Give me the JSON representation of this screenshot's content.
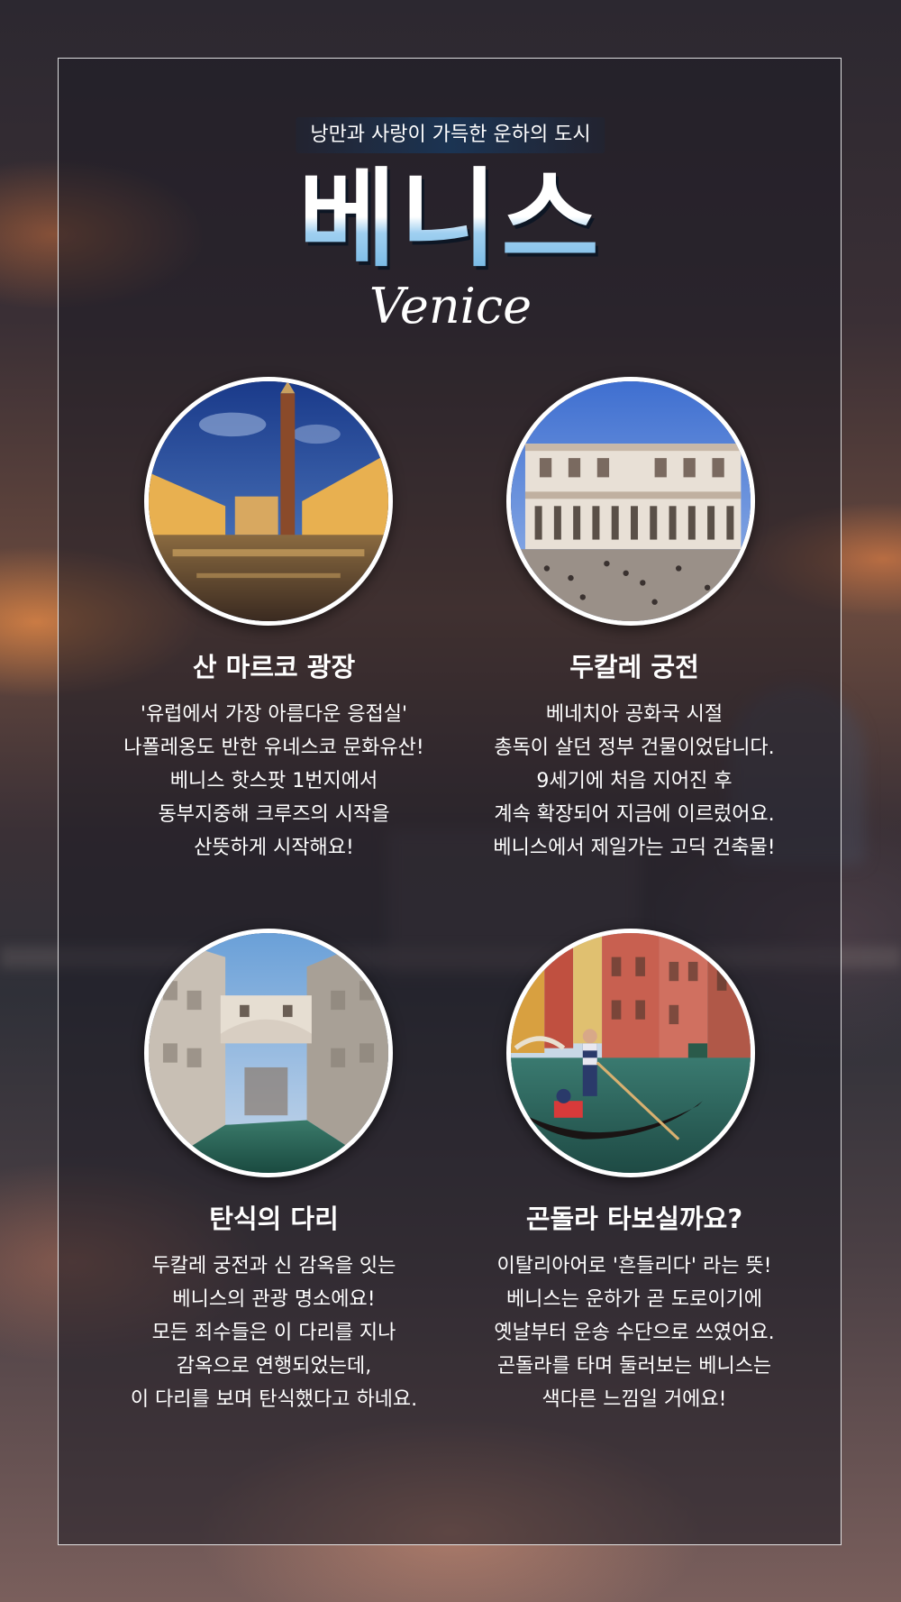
{
  "header": {
    "tagline": "낭만과 사랑이 가득한 운하의 도시",
    "title": "베니스",
    "subtitle": "Venice"
  },
  "cards": [
    {
      "title": "산 마르코 광장",
      "lines": [
        "'유럽에서 가장 아름다운 응접실'",
        "나폴레옹도 반한 유네스코 문화유산!",
        "베니스 핫스팟 1번지에서",
        "동부지중해 크루즈의 시작을",
        "산뜻하게 시작해요!"
      ]
    },
    {
      "title": "두칼레 궁전",
      "lines": [
        "베네치아 공화국 시절",
        "총독이 살던 정부 건물이었답니다.",
        "9세기에 처음 지어진 후",
        "계속 확장되어 지금에 이르렀어요.",
        "베니스에서 제일가는 고딕 건축물!"
      ]
    },
    {
      "title": "탄식의 다리",
      "lines": [
        "두칼레 궁전과 신 감옥을 잇는",
        "베니스의 관광 명소에요!",
        "모든 죄수들은 이 다리를 지나",
        "감옥으로 연행되었는데,",
        "이 다리를 보며 탄식했다고 하네요."
      ]
    },
    {
      "title": "곤돌라 타보실까요?",
      "lines": [
        "이탈리아어로 '흔들리다' 라는 뜻!",
        "베니스는 운하가 곧 도로이기에",
        "옛날부터 운송 수단으로 쓰였어요.",
        "곤돌라를 타며 둘러보는 베니스는",
        "색다른 느낌일 거에요!"
      ]
    }
  ],
  "photos": [
    "piazza-san-marco-photo",
    "doge-palace-photo",
    "bridge-of-sighs-photo",
    "gondola-canal-photo"
  ]
}
